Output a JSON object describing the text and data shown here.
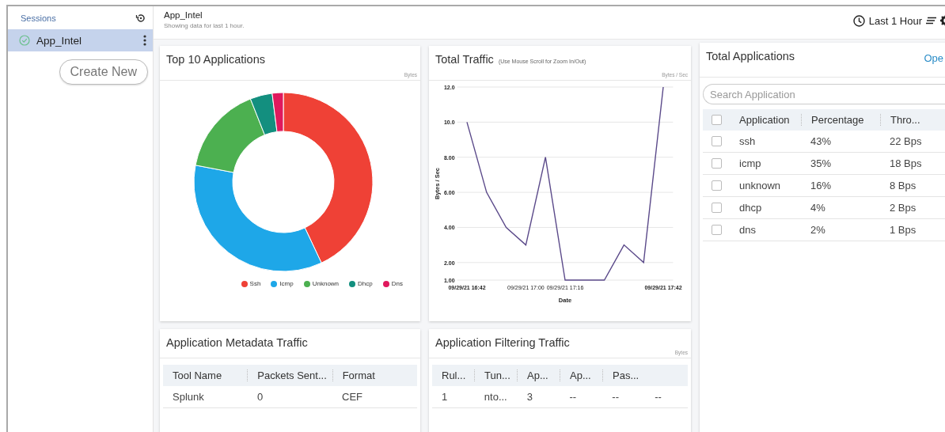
{
  "sidebar": {
    "title": "Sessions",
    "sessions": [
      {
        "name": "App_Intel",
        "selected": true
      }
    ],
    "create_button": "Create New"
  },
  "header": {
    "title": "App_Intel",
    "subtitle": "Showing data for last 1 hour.",
    "time_range": "Last 1 Hour"
  },
  "top_applications": {
    "title": "Top 10 Applications",
    "unit": "Bytes",
    "chart_data": {
      "type": "donut",
      "categories": [
        "Ssh",
        "Icmp",
        "Unknown",
        "Dhcp",
        "Dns"
      ],
      "values": [
        43,
        35,
        16,
        4,
        2
      ],
      "colors": [
        "#ef4136",
        "#1ea7e8",
        "#4cb050",
        "#138f7f",
        "#e0195d"
      ]
    }
  },
  "total_traffic": {
    "title": "Total Traffic",
    "hint": "(Use Mouse Scroll for Zoom In/Out)",
    "unit": "Bytes / Sec",
    "chart_data": {
      "type": "line",
      "xlabel": "Date",
      "ylabel": "Bytes / Sec",
      "categories": [
        "09/29/21 16:42",
        null,
        null,
        "09/29/21 17:00",
        null,
        "09/29/21 17:16",
        null,
        null,
        null,
        null,
        "09/29/21 17:42"
      ],
      "series": [
        {
          "color": "#5b4a8a",
          "values": [
            10,
            6,
            4,
            3,
            8,
            1,
            1,
            1,
            3,
            2,
            12
          ]
        }
      ],
      "ylim": [
        1,
        12
      ],
      "grid": true,
      "yticks": [
        {
          "value": 1,
          "label": "1.00"
        },
        {
          "value": 2,
          "label": "2.00"
        },
        {
          "value": 4,
          "label": "4.00"
        },
        {
          "value": 6,
          "label": "6.00"
        },
        {
          "value": 8,
          "label": "8.00"
        },
        {
          "value": 10,
          "label": "10.0"
        },
        {
          "value": 12,
          "label": "12.0"
        }
      ]
    }
  },
  "total_applications": {
    "title": "Total Applications",
    "link": "Ope",
    "search": {
      "placeholder": "Search Application"
    },
    "select_all_checked": false,
    "columns": [
      "Application",
      "Percentage",
      "Thro..."
    ],
    "rows": [
      {
        "cells": [
          "ssh",
          "43%",
          "22 Bps"
        ],
        "checked": false
      },
      {
        "cells": [
          "icmp",
          "35%",
          "18 Bps"
        ],
        "checked": false
      },
      {
        "cells": [
          "unknown",
          "16%",
          "8 Bps"
        ],
        "checked": false
      },
      {
        "cells": [
          "dhcp",
          "4%",
          "2 Bps"
        ],
        "checked": false
      },
      {
        "cells": [
          "dns",
          "2%",
          "1 Bps"
        ],
        "checked": false
      }
    ]
  },
  "metadata_traffic": {
    "title": "Application Metadata Traffic",
    "columns": [
      "Tool Name",
      "Packets Sent...",
      "Format"
    ],
    "rows": [
      [
        "Splunk",
        "0",
        "CEF"
      ]
    ]
  },
  "filtering_traffic": {
    "title": "Application Filtering Traffic",
    "unit": "Bytes",
    "columns": [
      "Rul...",
      "Tun...",
      "Ap...",
      "Ap...",
      "Pas..."
    ],
    "rows": [
      [
        "1",
        "nto...",
        "3",
        "--",
        "--",
        "--"
      ]
    ]
  }
}
